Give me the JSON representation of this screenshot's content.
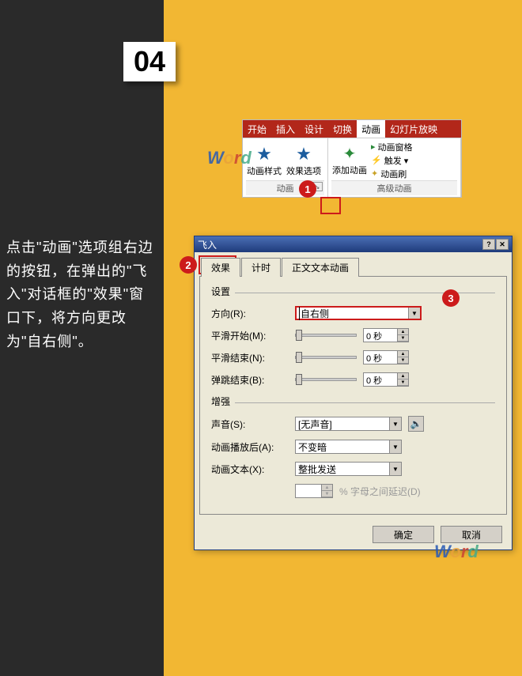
{
  "step": "04",
  "instruction": "点击\"动画\"选项组右边的按钮，在弹出的\"飞入\"对话框的\"效果\"窗口下，将方向更改为\"自右侧\"。",
  "ribbon": {
    "tabs": [
      "开始",
      "插入",
      "设计",
      "切换",
      "动画",
      "幻灯片放映"
    ],
    "active_tab": "动画",
    "group1": {
      "btn1": "动画样式",
      "btn2": "效果选项",
      "label": "动画"
    },
    "group2": {
      "btn1": "添加动画",
      "items": [
        "动画窗格",
        "触发 ▾",
        "动画刷"
      ],
      "label": "高级动画"
    }
  },
  "dialog": {
    "title": "飞入",
    "tabs": [
      "效果",
      "计时",
      "正文文本动画"
    ],
    "active_tab": "效果",
    "section1": "设置",
    "direction_label": "方向(R):",
    "direction_value": "自右侧",
    "smooth_start_label": "平滑开始(M):",
    "smooth_start_value": "0 秒",
    "smooth_end_label": "平滑结束(N):",
    "smooth_end_value": "0 秒",
    "bounce_label": "弹跳结束(B):",
    "bounce_value": "0 秒",
    "section2": "增强",
    "sound_label": "声音(S):",
    "sound_value": "[无声音]",
    "after_label": "动画播放后(A):",
    "after_value": "不变暗",
    "text_label": "动画文本(X):",
    "text_value": "整批发送",
    "letter_delay": "% 字母之间延迟(D)",
    "ok": "确定",
    "cancel": "取消"
  },
  "markers": {
    "m1": "1",
    "m2": "2",
    "m3": "3"
  },
  "watermark": {
    "w": "W",
    "o": "o",
    "r": "r",
    "d": "d"
  }
}
